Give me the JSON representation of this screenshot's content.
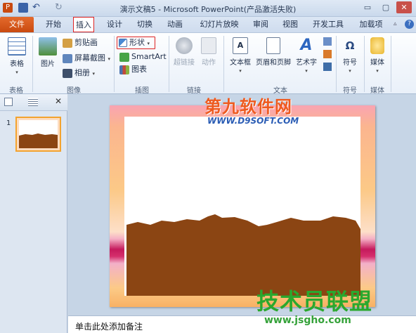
{
  "window": {
    "title": "演示文稿5 - Microsoft PowerPoint(产品激活失败)",
    "qat_powerpoint": "P",
    "controls": {
      "minimize": "▭",
      "restore": "▢",
      "close": "✕"
    }
  },
  "tabs": [
    "文件",
    "开始",
    "插入",
    "设计",
    "切换",
    "动画",
    "幻灯片放映",
    "审阅",
    "视图",
    "开发工具",
    "加载项"
  ],
  "ribbon": {
    "groups": {
      "tables": "表格",
      "images": "图像",
      "illustrations": "插图",
      "links": "链接",
      "text": "文本",
      "symbols": "符号",
      "media": "媒体"
    },
    "table_btn": "表格",
    "picture_btn": "图片",
    "clipart_btn": "剪贴画",
    "screenshot_btn": "屏幕截图",
    "album_btn": "相册",
    "shapes_btn": "形状",
    "smartart_btn": "SmartArt",
    "chart_btn": "图表",
    "hyperlink_btn": "超链接",
    "action_btn": "动作",
    "textbox_btn": "文本框",
    "headerfooter_btn": "页眉和页脚",
    "wordart_btn": "艺术字",
    "symbol_btn": "符号",
    "symbol_glyph": "Ω",
    "media_btn": "媒体",
    "dropdown_glyph": "▾"
  },
  "slides_panel": {
    "slide_number": "1",
    "close_glyph": "✕"
  },
  "notes_placeholder": "单击此处添加备注",
  "watermarks": {
    "top": "第九软件网",
    "top_url": "WWW.D9SOFT.COM",
    "bottom": "技术员联盟",
    "bottom_url": "www.jsgho.com"
  },
  "colors": {
    "file_tab": "#d0541a",
    "highlight": "#dd2222",
    "mountain": "#8b4513"
  }
}
